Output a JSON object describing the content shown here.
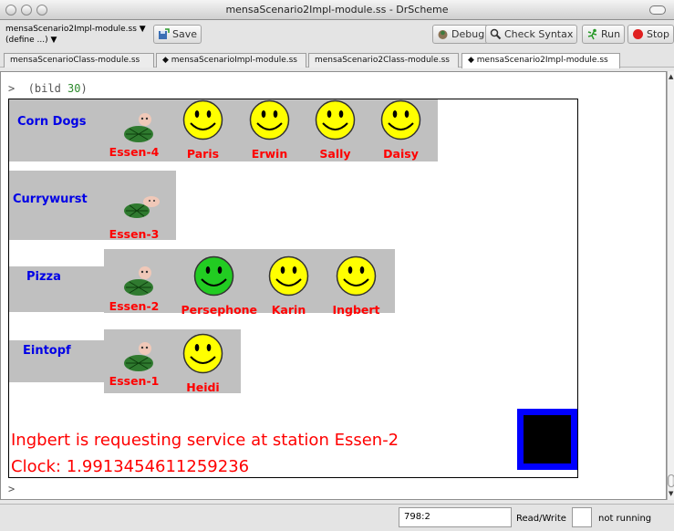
{
  "window": {
    "title": "mensaScenario2Impl-module.ss - DrScheme"
  },
  "toolbar": {
    "file_name": "mensaScenario2Impl-module.ss ▼",
    "define_menu": "(define ...) ▼",
    "save_label": "Save",
    "debug_label": "Debug",
    "check_syntax_label": "Check Syntax",
    "run_label": "Run",
    "stop_label": "Stop"
  },
  "tabs": [
    {
      "label": "mensaScenarioClass-module.ss"
    },
    {
      "label": "◆ mensaScenarioImpl-module.ss"
    },
    {
      "label": "mensaScenario2Class-module.ss"
    },
    {
      "label": "◆ mensaScenario2Impl-module.ss"
    }
  ],
  "repl": {
    "prompt": ">",
    "expr_open": "(bild ",
    "expr_arg": "30",
    "expr_close": ")",
    "prompt2": ">"
  },
  "stations": [
    {
      "name": "Corn Dogs",
      "food_label": "Essen-4",
      "customers": [
        {
          "name": "Paris",
          "color": "#ffff00"
        },
        {
          "name": "Erwin",
          "color": "#ffff00"
        },
        {
          "name": "Sally",
          "color": "#ffff00"
        },
        {
          "name": "Daisy",
          "color": "#ffff00"
        }
      ]
    },
    {
      "name": "Currywurst",
      "food_label": "Essen-3",
      "customers": []
    },
    {
      "name": "Pizza",
      "food_label": "Essen-2",
      "customers": [
        {
          "name": "Persephone",
          "color": "#22cc22"
        },
        {
          "name": "Karin",
          "color": "#ffff00"
        },
        {
          "name": "Ingbert",
          "color": "#ffff00"
        }
      ]
    },
    {
      "name": "Eintopf",
      "food_label": "Essen-1",
      "customers": [
        {
          "name": "Heidi",
          "color": "#ffff00"
        }
      ]
    }
  ],
  "canvas": {
    "message": "Ingbert is requesting service at station Essen-2",
    "clock": "Clock: 1.9913454611259236",
    "colors": {
      "block": "#c0c0c0",
      "station_label": "#0000e6",
      "red_text": "#ff0000",
      "status_box": "#0000ff"
    }
  },
  "status_bar": {
    "position": "798:2",
    "mode": "Read/Write",
    "state": "not running"
  }
}
